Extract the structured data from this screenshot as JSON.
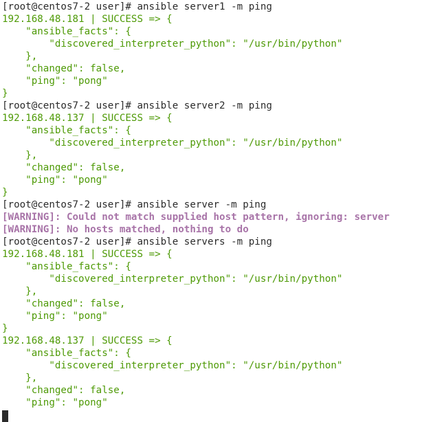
{
  "terminal": {
    "lines": [
      {
        "text": "[root@centos7-2 user]# ansible server1 -m ping",
        "kind": "prompt"
      },
      {
        "text": "192.168.48.181 | SUCCESS => {",
        "kind": "ok"
      },
      {
        "text": "    \"ansible_facts\": {",
        "kind": "ok"
      },
      {
        "text": "        \"discovered_interpreter_python\": \"/usr/bin/python\"",
        "kind": "ok"
      },
      {
        "text": "    },",
        "kind": "ok"
      },
      {
        "text": "    \"changed\": false,",
        "kind": "ok"
      },
      {
        "text": "    \"ping\": \"pong\"",
        "kind": "ok"
      },
      {
        "text": "}",
        "kind": "ok"
      },
      {
        "text": "[root@centos7-2 user]# ansible server2 -m ping",
        "kind": "prompt"
      },
      {
        "text": "192.168.48.137 | SUCCESS => {",
        "kind": "ok"
      },
      {
        "text": "    \"ansible_facts\": {",
        "kind": "ok"
      },
      {
        "text": "        \"discovered_interpreter_python\": \"/usr/bin/python\"",
        "kind": "ok"
      },
      {
        "text": "    },",
        "kind": "ok"
      },
      {
        "text": "    \"changed\": false,",
        "kind": "ok"
      },
      {
        "text": "    \"ping\": \"pong\"",
        "kind": "ok"
      },
      {
        "text": "}",
        "kind": "ok"
      },
      {
        "text": "[root@centos7-2 user]# ansible server -m ping",
        "kind": "prompt"
      },
      {
        "text": "[WARNING]: Could not match supplied host pattern, ignoring: server",
        "kind": "warn"
      },
      {
        "text": "[WARNING]: No hosts matched, nothing to do",
        "kind": "warn"
      },
      {
        "text": "[root@centos7-2 user]# ansible servers -m ping",
        "kind": "prompt"
      },
      {
        "text": "192.168.48.181 | SUCCESS => {",
        "kind": "ok"
      },
      {
        "text": "    \"ansible_facts\": {",
        "kind": "ok"
      },
      {
        "text": "        \"discovered_interpreter_python\": \"/usr/bin/python\"",
        "kind": "ok"
      },
      {
        "text": "    },",
        "kind": "ok"
      },
      {
        "text": "    \"changed\": false,",
        "kind": "ok"
      },
      {
        "text": "    \"ping\": \"pong\"",
        "kind": "ok"
      },
      {
        "text": "}",
        "kind": "ok"
      },
      {
        "text": "192.168.48.137 | SUCCESS => {",
        "kind": "ok"
      },
      {
        "text": "    \"ansible_facts\": {",
        "kind": "ok"
      },
      {
        "text": "        \"discovered_interpreter_python\": \"/usr/bin/python\"",
        "kind": "ok"
      },
      {
        "text": "    },",
        "kind": "ok"
      },
      {
        "text": "    \"changed\": false,",
        "kind": "ok"
      },
      {
        "text": "    \"ping\": \"pong\"",
        "kind": "ok"
      },
      {
        "text": "}",
        "kind": "ok"
      }
    ]
  },
  "colors": {
    "background": "#ffffff",
    "prompt_text": "#2b2b2b",
    "success_output": "#4e9a06",
    "warning_output": "#a874a8"
  }
}
